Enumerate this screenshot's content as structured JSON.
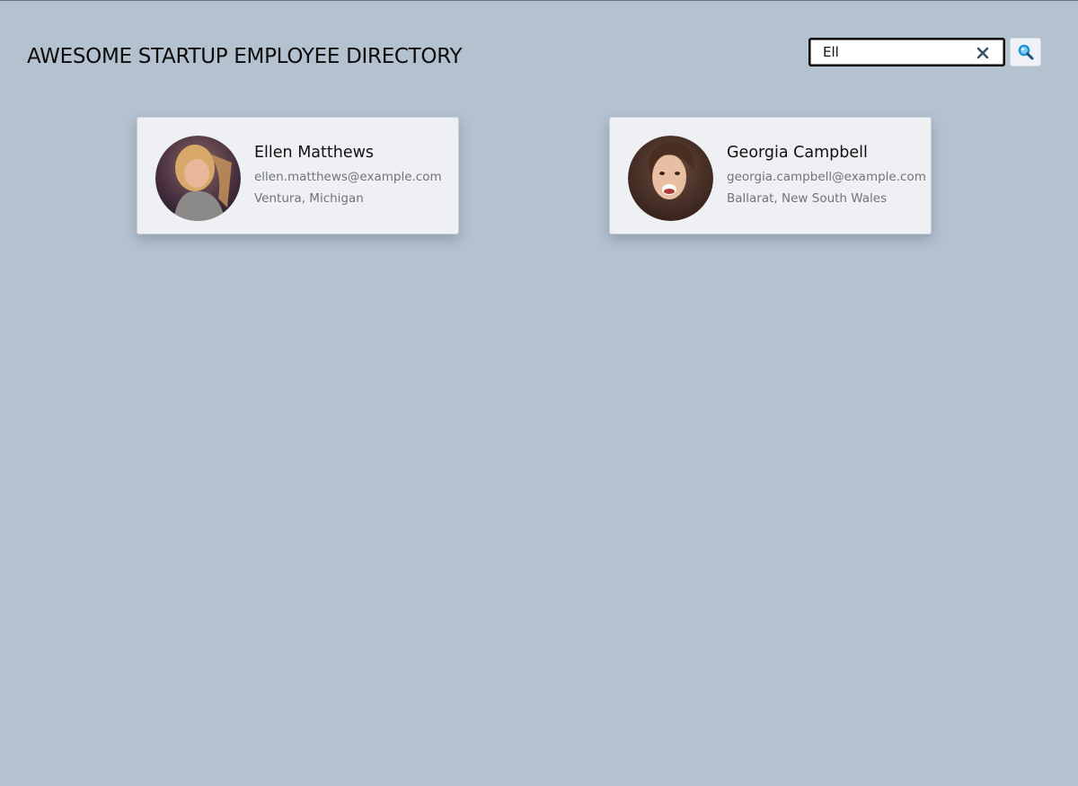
{
  "header": {
    "title": "AWESOME STARTUP EMPLOYEE DIRECTORY"
  },
  "search": {
    "value": "Ell",
    "clear_icon": "close-icon",
    "button_icon": "magnifier-icon",
    "border_color": "#000000"
  },
  "employees": [
    {
      "name": "Ellen Matthews",
      "email": "ellen.matthews@example.com",
      "location": "Ventura, Michigan"
    },
    {
      "name": "Georgia Campbell",
      "email": "georgia.campbell@example.com",
      "location": "Ballarat, New South Wales"
    }
  ],
  "colors": {
    "background": "#b4c2d0",
    "card_background": "#eef0f3",
    "secondary_text": "#707378",
    "search_icon": "#1a8fd8",
    "clear_icon": "#3d5166"
  }
}
